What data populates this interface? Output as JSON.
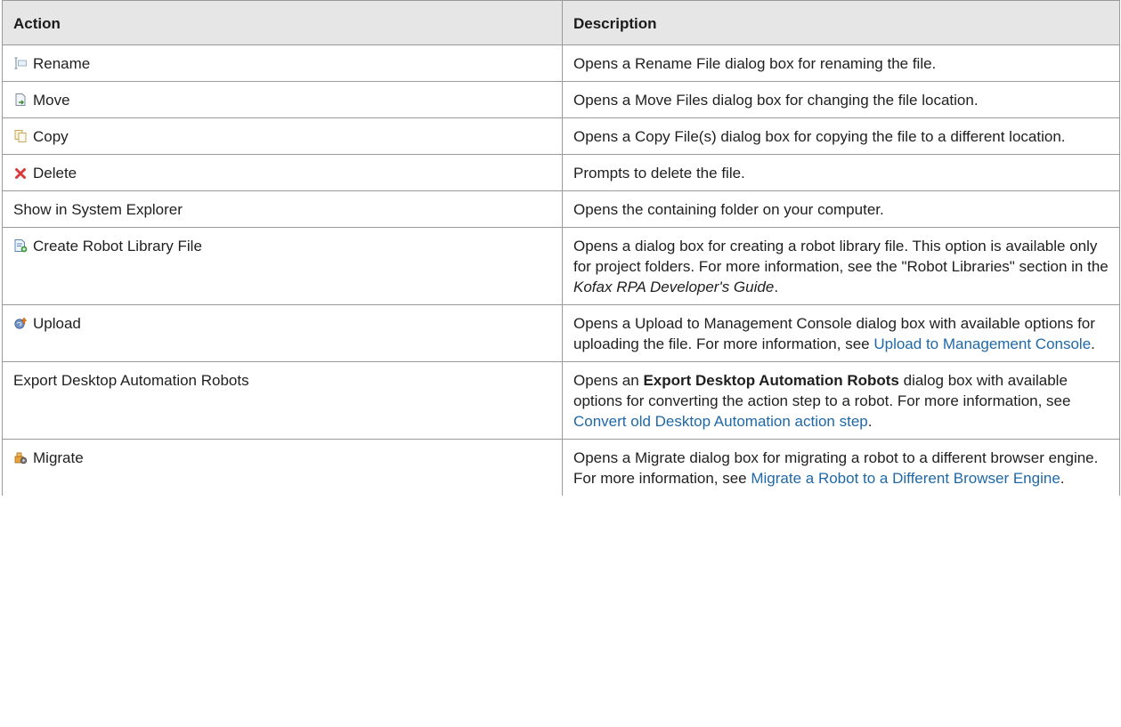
{
  "header": {
    "action": "Action",
    "description": "Description"
  },
  "rows": [
    {
      "action": "Rename",
      "icon": "rename-icon",
      "desc": [
        "Opens a Rename File dialog box for renaming the file."
      ]
    },
    {
      "action": "Move",
      "icon": "move-icon",
      "desc": [
        "Opens a Move Files dialog box for changing the file location."
      ]
    },
    {
      "action": "Copy",
      "icon": "copy-icon",
      "desc": [
        "Opens a Copy File(s) dialog box for copying the file to a different location."
      ]
    },
    {
      "action": "Delete",
      "icon": "delete-icon",
      "desc": [
        "Prompts to delete the file."
      ]
    },
    {
      "action": "Show in System Explorer",
      "icon": "",
      "desc": [
        "Opens the containing folder on your computer."
      ]
    },
    {
      "action": "Create Robot Library File",
      "icon": "robot-library-icon",
      "desc": [
        "Opens a dialog box for creating a robot library file. This option is available only for project folders. For more information, see the \"Robot Libraries\" section in the ",
        "Kofax RPA Developer's Guide",
        "."
      ]
    },
    {
      "action": "Upload",
      "icon": "upload-icon",
      "desc": [
        "Opens a Upload to Management Console dialog box with available options for uploading the file. For more information, see ",
        "Upload to Management Console",
        "."
      ]
    },
    {
      "action": "Export Desktop Automation Robots",
      "icon": "",
      "desc": [
        "Opens an ",
        "Export Desktop Automation Robots",
        " dialog box with available options for converting the action step to a robot. For more information, see ",
        "Convert old Desktop Automation action step",
        "."
      ]
    },
    {
      "action": "Migrate",
      "icon": "migrate-icon",
      "desc": [
        "Opens a Migrate dialog box for migrating a robot to a different browser engine. For more information, see ",
        "Migrate a Robot to a Different Browser Engine",
        "."
      ]
    }
  ],
  "colors": {
    "link": "#1f68a6",
    "header_bg": "#e6e6e6",
    "border": "#9a9a9a"
  }
}
